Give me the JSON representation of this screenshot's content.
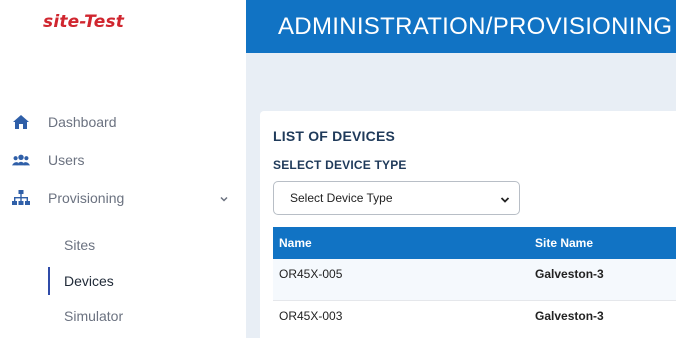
{
  "app": {
    "logo_text": "site-Test"
  },
  "header": {
    "title": "ADMINISTRATION/PROVISIONING"
  },
  "sidebar": {
    "items": [
      {
        "label": "Dashboard",
        "icon": "home-icon"
      },
      {
        "label": "Users",
        "icon": "users-icon"
      },
      {
        "label": "Provisioning",
        "icon": "sitemap-icon",
        "expanded": true
      }
    ],
    "sub_items": [
      {
        "label": "Sites",
        "active": false
      },
      {
        "label": "Devices",
        "active": true
      },
      {
        "label": "Simulator",
        "active": false
      }
    ]
  },
  "main": {
    "card_title": "LIST OF DEVICES",
    "select_label": "SELECT DEVICE TYPE",
    "select_value": "Select Device Type",
    "table": {
      "columns": [
        "Name",
        "Site Name"
      ],
      "rows": [
        [
          "OR45X-005",
          "Galveston-3"
        ],
        [
          "OR45X-003",
          "Galveston-3"
        ]
      ]
    }
  },
  "colors": {
    "brand_red": "#d0262f",
    "header_blue": "#1173c4",
    "active_indicator": "#2f4ba8",
    "icon_blue": "#2f5fa8"
  }
}
